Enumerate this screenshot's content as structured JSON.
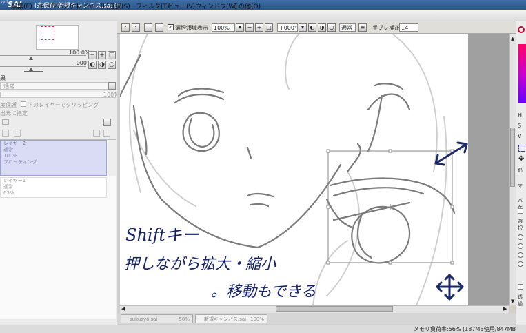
{
  "window": {
    "logo": "SAI",
    "logo_prefix": "ool",
    "title": "(未保存)新規キャンバス.sai (*)"
  },
  "menu": [
    {
      "label": "編集(E)"
    },
    {
      "label": "キャンバス(C)"
    },
    {
      "label": "レイヤー(L)"
    },
    {
      "label": "選択(S)"
    },
    {
      "label": "フィルタ(T)"
    },
    {
      "label": "ビュー(V)"
    },
    {
      "label": "ウィンドウ(W)"
    },
    {
      "label": "その他(O)"
    }
  ],
  "left_panel": {
    "zoom_value": "100.0%",
    "rotate_value": "+000°",
    "mode_label": "果",
    "blend_mode": "通常",
    "opacity_value": "100%",
    "protect_opacity": "度保護",
    "clip_lower": "下のレイヤーでクリッピング",
    "select_source": "出元に指定",
    "layers": [
      {
        "name": "レイヤー2",
        "mode": "通常",
        "opacity": "100%",
        "extra": "フローティング",
        "selected": true
      },
      {
        "name": "レイヤー1",
        "mode": "通常",
        "opacity": "65%",
        "extra": "",
        "selected": false
      }
    ]
  },
  "toolbar": {
    "show_selection_label": "選択領域表示",
    "show_selection_checked": true,
    "zoom": "100%",
    "rotation": "+000°",
    "mode": "通常",
    "stabilizer_label": "手ブレ補正",
    "stabilizer_value": "14"
  },
  "canvas": {
    "annotation_line1": "Shiftキー",
    "annotation_line2": "押しながら拡大・縮小",
    "annotation_line3": "。移動もできる"
  },
  "tabs": [
    {
      "name": "sukusyo.sai",
      "zoom": "50%",
      "active": false
    },
    {
      "name": "新規キャンバス.sai",
      "zoom": "100%",
      "active": true
    }
  ],
  "status": {
    "memory": "メモリ負荷率:56% (187MB使用/847MB"
  },
  "right_panel": {
    "h_label": "H",
    "s_label": "S",
    "v_label": "V",
    "extra1": "鉛",
    "extra2": "マ",
    "extra3": "バケ",
    "extra4": "選択",
    "extra5": "透過"
  }
}
